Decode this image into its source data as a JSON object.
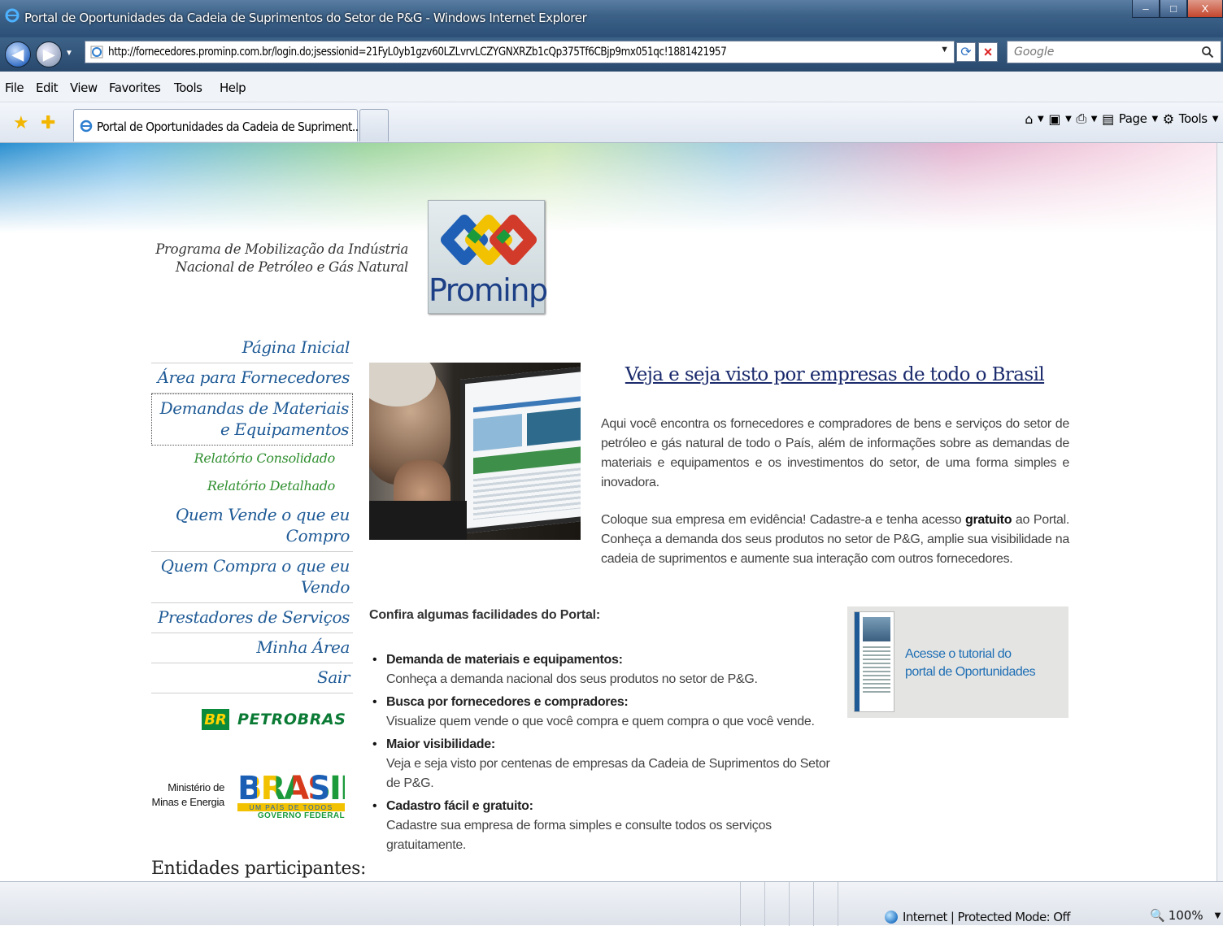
{
  "window": {
    "title": "Portal de Oportunidades da Cadeia de Suprimentos do Setor de P&G - Windows Internet Explorer",
    "buttons": [
      "–",
      "□",
      "X"
    ]
  },
  "address": {
    "url": "http://fornecedores.prominp.com.br/login.do;jsessionid=21FyL0yb1gzv60LZLvrvLCZYGNXRZb1cQp375Tf6CBjp9mx051qc!1881421957",
    "search_placeholder": "Google"
  },
  "menu": [
    "File",
    "Edit",
    "View",
    "Favorites",
    "Tools",
    "Help"
  ],
  "tab": {
    "label": "Portal de Oportunidades da Cadeia de Supriment..."
  },
  "command_bar": {
    "page": "Page",
    "tools": "Tools"
  },
  "header": {
    "program_title": "Programa de Mobilização da Indústria Nacional de Petróleo e Gás Natural",
    "logo_text": "Prominp"
  },
  "sidenav": {
    "items": [
      {
        "label": "Página Inicial"
      },
      {
        "label": "Área para Fornecedores"
      },
      {
        "label": "Demandas de Materiais e Equipamentos"
      },
      {
        "label": "Relatório Consolidado"
      },
      {
        "label": "Relatório Detalhado"
      },
      {
        "label": "Quem Vende o que eu Compro"
      },
      {
        "label": "Quem Compra o que eu Vendo"
      },
      {
        "label": "Prestadores de Serviços"
      },
      {
        "label": "Minha Área"
      },
      {
        "label": "Sair"
      }
    ]
  },
  "sponsors": {
    "petrobras_br": "BR",
    "petrobras_name": "PETROBRAS",
    "ministerio_line1": "Ministério de",
    "ministerio_line2": "Minas e Energia",
    "brasil_word": "BRASIL",
    "brasil_sub": "UM PAÍS DE TODOS",
    "brasil_gov": "GOVERNO FEDERAL",
    "entidades": "Entidades participantes:"
  },
  "main": {
    "headline": "Veja e seja visto por empresas de todo o Brasil",
    "para1": "Aqui você encontra os fornecedores e compradores de bens e serviços do setor de petróleo e gás natural de todo o País, além de informações sobre as demandas de materiais e equipamentos e os investimentos do setor, de uma forma simples e inovadora.",
    "para2_pre": "Coloque sua empresa em evidência! Cadastre-a e tenha acesso ",
    "para2_bold": "gratuito",
    "para2_post": " ao Portal. Conheça a demanda dos seus produtos no setor de P&G, amplie sua visibilidade na cadeia de suprimentos e aumente sua interação com outros fornecedores.",
    "confira": "Confira algumas facilidades do Portal:",
    "features": [
      {
        "title": "Demanda de materiais e equipamentos:",
        "text": "Conheça a demanda nacional dos seus produtos no setor de P&G."
      },
      {
        "title": "Busca por fornecedores e compradores:",
        "text": "Visualize quem vende o que você compra e quem compra o que você vende."
      },
      {
        "title": "Maior visibilidade:",
        "text": "Veja e seja visto por centenas de empresas da Cadeia de Suprimentos do Setor de P&G."
      },
      {
        "title": "Cadastro fácil e gratuito:",
        "text": "Cadastre sua empresa de forma simples e consulte todos os serviços gratuitamente."
      }
    ],
    "tutorial_line1": "Acesse o tutorial do",
    "tutorial_line2": "portal de Oportunidades"
  },
  "status": {
    "zone": "Internet | Protected Mode: Off",
    "zoom": "100%"
  },
  "colors": {
    "nav_link": "#1e5a96",
    "subnav_link": "#2f8f2f",
    "headline": "#1a2a6c",
    "tutorial_link": "#1f6fb5"
  }
}
